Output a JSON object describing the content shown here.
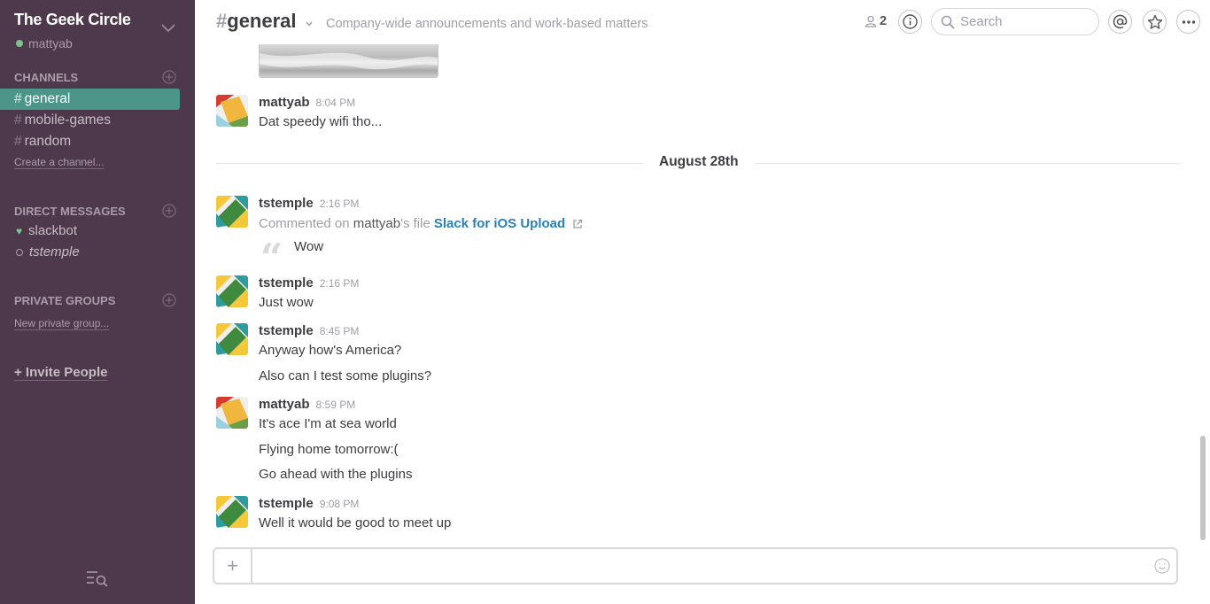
{
  "sidebar": {
    "team_name": "The Geek Circle",
    "user_name": "mattyab",
    "channels_header": "CHANNELS",
    "channels": [
      {
        "hash": "#",
        "name": "general"
      },
      {
        "hash": "#",
        "name": "mobile-games"
      },
      {
        "hash": "#",
        "name": "random"
      }
    ],
    "create_channel": "Create a channel...",
    "dm_header": "DIRECT MESSAGES",
    "dms": [
      {
        "name": "slackbot"
      },
      {
        "name": "tstemple"
      }
    ],
    "groups_header": "PRIVATE GROUPS",
    "new_group": "New private group...",
    "invite": "+ Invite People",
    "icons": {
      "team_menu": "chevron-down-icon",
      "add": "plus-circle-icon",
      "search": "list-search-icon"
    }
  },
  "header": {
    "hash": "#",
    "channel": "general",
    "purpose": "Company-wide announcements and work-based matters",
    "member_count": "2",
    "search_placeholder": "Search",
    "icons": [
      "member-icon",
      "info-icon",
      "search-icon",
      "at-mention-icon",
      "star-icon",
      "more-icon"
    ]
  },
  "messages": {
    "day_divider": "August 28th",
    "items": [
      {
        "author": "mattyab",
        "time": "8:04 PM",
        "lines": [
          "Dat speedy wifi tho..."
        ]
      },
      {
        "author": "tstemple",
        "time": "2:16 PM",
        "comment": {
          "prefix": "Commented on",
          "owner": "mattyab",
          "suffix": "'s file",
          "file": "Slack for iOS Upload",
          "quote": "Wow"
        }
      },
      {
        "author": "tstemple",
        "time": "2:16 PM",
        "lines": [
          "Just wow"
        ]
      },
      {
        "author": "tstemple",
        "time": "8:45 PM",
        "lines": [
          "Anyway how's America?",
          "Also can I test some plugins?"
        ]
      },
      {
        "author": "mattyab",
        "time": "8:59 PM",
        "lines": [
          "It's ace I'm at sea world",
          "Flying home tomorrow:(",
          "Go ahead with the plugins"
        ]
      },
      {
        "author": "tstemple",
        "time": "9:08 PM",
        "lines": [
          "Well it would be good to meet up"
        ]
      }
    ]
  },
  "composer": {
    "plus": "+",
    "value": ""
  },
  "colors": {
    "sidebar": "#4d394b",
    "active_channel": "#4c9689",
    "link": "#2a80b9",
    "presence": "#7ec38a"
  }
}
